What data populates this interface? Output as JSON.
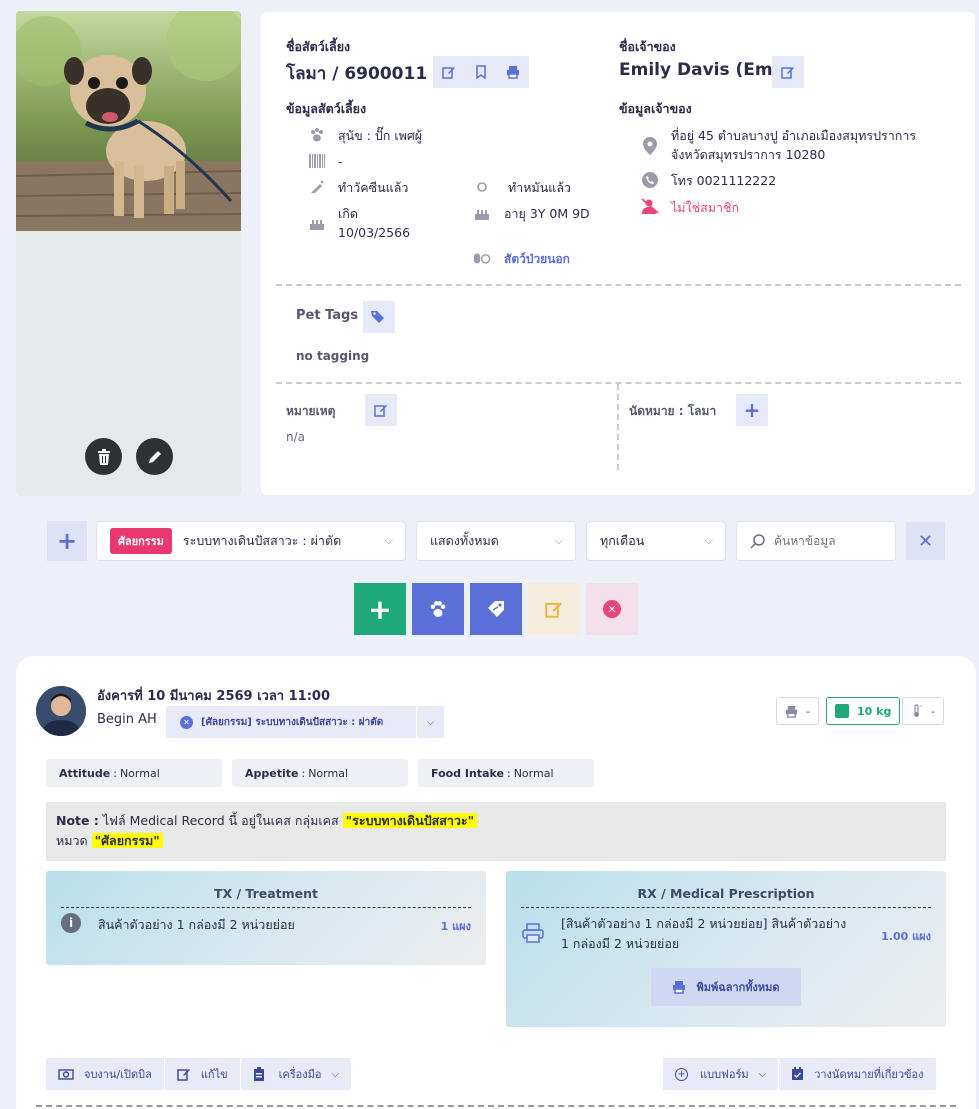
{
  "pet": {
    "name_label": "ชื่อสัตว์เลี้ยง",
    "name": "โลมา / 6900011",
    "info_label": "ข้อมูลสัตว์เลี้ยง",
    "species": "สุนัข : ปั๊ก เพศผู้",
    "microchip": "-",
    "vaccinated": "ทำวัคซีนแล้ว",
    "neutered": "ทำหมันแล้ว",
    "birth_label": "เกิด",
    "birth_date": "10/03/2566",
    "age": "อายุ 3Y 0M 9D",
    "patient_type": "สัตว์ป่วยนอก"
  },
  "owner": {
    "name_label": "ชื่อเจ้าของ",
    "name": "Emily Davis (Em)",
    "info_label": "ข้อมูลเจ้าของ",
    "address_line1": "ที่อยู่ 45 ตำบลบางปู อำเภอเมืองสมุทรปราการ",
    "address_line2": "จังหวัดสมุทรปราการ 10280",
    "phone": "โทร 0021112222",
    "member_status": "ไม่ใช่สมาชิก"
  },
  "tags": {
    "label": "Pet Tags",
    "empty_text": "no tagging"
  },
  "note_section": {
    "label": "หมายเหตุ",
    "value": "n/a"
  },
  "appointment": {
    "label": "นัดหมาย : โลมา"
  },
  "filters": {
    "category_badge": "ศัลยกรรม",
    "category_value": "ระบบทางเดินปัสสาวะ : ผ่าตัด",
    "show_value": "แสดงทั้งหมด",
    "month_value": "ทุกเดือน",
    "search_placeholder": "ค้นหาข้อมูล"
  },
  "record": {
    "datetime": "อังคารที่ 10 มีนาคม 2569 เวลา 11:00",
    "doctor": "Begin AH",
    "case_tag": "[ศัลยกรรม] ระบบทางเดินปัสสาวะ : ผ่าตัด",
    "print_value": "-",
    "weight": "10 kg",
    "temperature": "-",
    "attitude_label": "Attitude",
    "attitude_value": "Normal",
    "appetite_label": "Appetite",
    "appetite_value": "Normal",
    "food_label": "Food Intake",
    "food_value": "Normal",
    "note_prefix": "Note :",
    "note_text": "ไฟล์ Medical Record นี้ อยู่ในเคส กลุ่มเคส",
    "note_group": "\"ระบบทางเดินปัสสาวะ\"",
    "note_cat_prefix": "หมวด",
    "note_category": "\"ศัลยกรรม\"",
    "tx_title": "TX / Treatment",
    "tx_item": "สินค้าตัวอย่าง 1 กล่องมี 2 หน่วยย่อย",
    "tx_qty": "1 แผง",
    "rx_title": "RX / Medical Prescription",
    "rx_item_line1": "[สินค้าตัวอย่าง 1 กล่องมี 2 หน่วยย่อย] สินค้าตัวอย่าง",
    "rx_item_line2": "1 กล่องมี 2 หน่วยย่อย",
    "rx_qty": "1.00 แผง",
    "print_all_label": "พิมพ์ฉลากทั้งหมด",
    "btn_billing": "จบงาน/เปิดบิล",
    "btn_edit": "แก้ไข",
    "btn_tools": "เครื่องมือ",
    "btn_form": "แบบฟอร์ม",
    "btn_appointment": "วางนัดหมายที่เกี่ยวข้อง"
  },
  "colors": {
    "accent": "#5b6fd8",
    "green": "#1fa97a",
    "pink": "#e8457a",
    "tag_red": "#e8386d"
  }
}
